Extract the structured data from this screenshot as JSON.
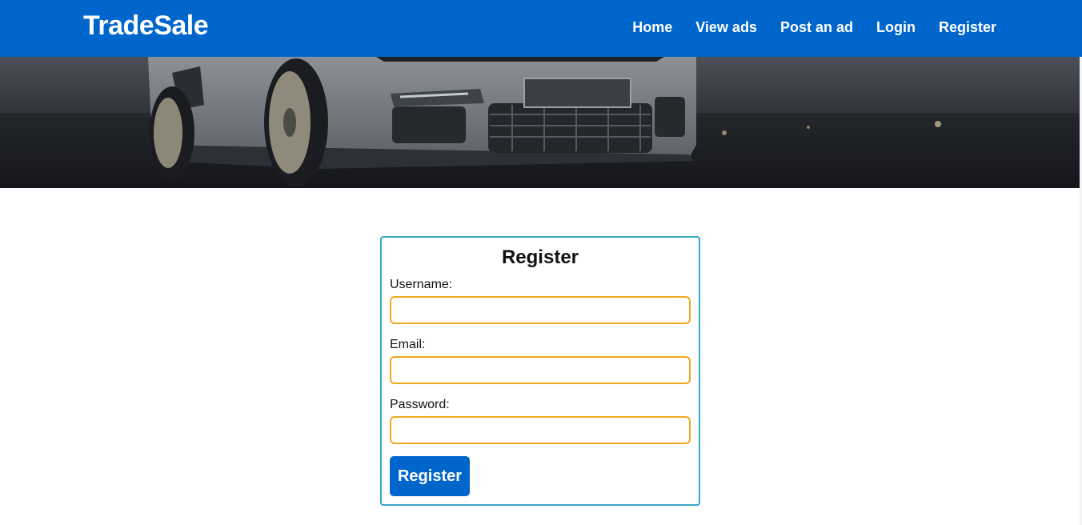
{
  "header": {
    "brand": "TradeSale",
    "nav": [
      {
        "label": "Home"
      },
      {
        "label": "View ads"
      },
      {
        "label": "Post an ad"
      },
      {
        "label": "Login"
      },
      {
        "label": "Register"
      }
    ]
  },
  "hero": {
    "image": "sports-car-front"
  },
  "form": {
    "title": "Register",
    "fields": {
      "username": {
        "label": "Username:",
        "value": ""
      },
      "email": {
        "label": "Email:",
        "value": ""
      },
      "password": {
        "label": "Password:",
        "value": ""
      }
    },
    "submit_label": "Register"
  },
  "colors": {
    "brand_blue": "#0066cc",
    "card_border": "#35a8c7",
    "input_border": "#f0a81c"
  }
}
